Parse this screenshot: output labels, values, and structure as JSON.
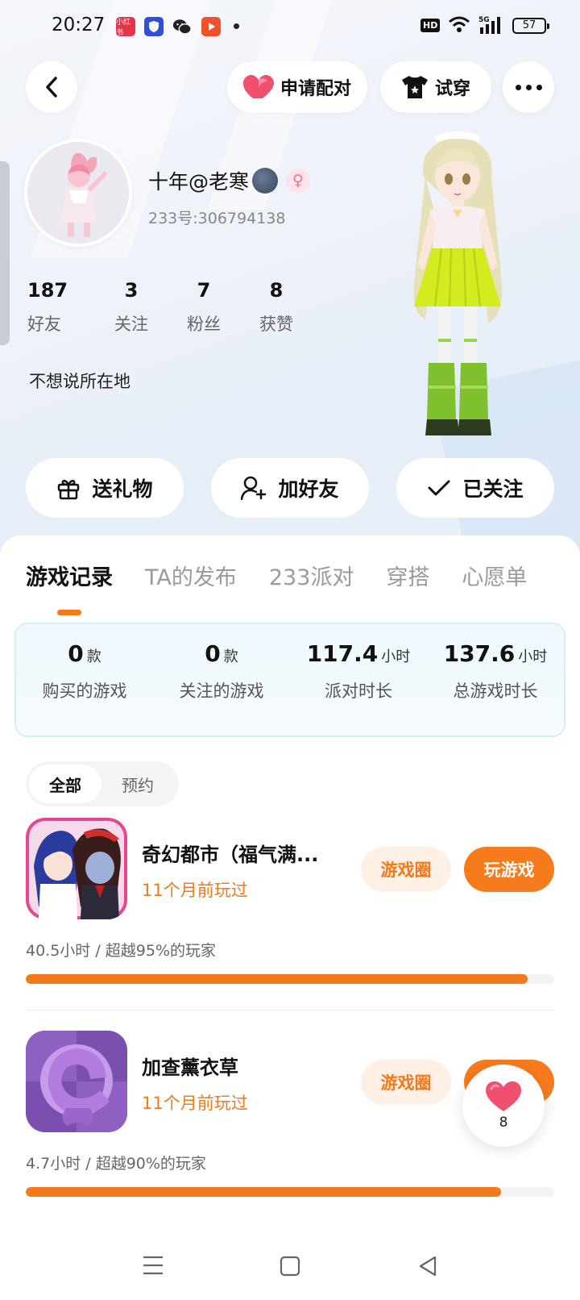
{
  "status_bar": {
    "time": "20:27",
    "battery": "57",
    "app_icons": [
      "xiaohongshu-app",
      "security-app",
      "wechat-app",
      "video-app"
    ]
  },
  "header": {
    "match_label": "申请配对",
    "try_on_label": "试穿"
  },
  "profile": {
    "nickname": "十年@老寒",
    "uid": "233号:306794138",
    "location": "不想说所在地",
    "stats": [
      {
        "value": "187",
        "label": "好友"
      },
      {
        "value": "3",
        "label": "关注"
      },
      {
        "value": "7",
        "label": "粉丝"
      },
      {
        "value": "8",
        "label": "获赞"
      }
    ]
  },
  "actions": {
    "gift": "送礼物",
    "add_friend": "加好友",
    "followed": "已关注"
  },
  "tabs": [
    "游戏记录",
    "TA的发布",
    "233派对",
    "穿搭",
    "心愿单"
  ],
  "summary": [
    {
      "value": "0",
      "unit": "款",
      "label": "购买的游戏"
    },
    {
      "value": "0",
      "unit": "款",
      "label": "关注的游戏"
    },
    {
      "value": "117.4",
      "unit": "小时",
      "label": "派对时长"
    },
    {
      "value": "137.6",
      "unit": "小时",
      "label": "总游戏时长"
    }
  ],
  "filter": {
    "all": "全部",
    "reserve": "预约"
  },
  "games": [
    {
      "name": "奇幻都市（福气满...",
      "last_played": "11个月前玩过",
      "circle": "游戏圈",
      "play": "玩游戏",
      "time_text": "40.5小时 / 超越95%的玩家",
      "progress": 0.95
    },
    {
      "name": "加查薰衣草",
      "last_played": "11个月前玩过",
      "circle": "游戏圈",
      "play": "玩游戏",
      "time_text": "4.7小时 / 超越90%的玩家",
      "progress": 0.9
    }
  ],
  "like": {
    "count": "8"
  },
  "colors": {
    "accent": "#f27a1a",
    "accent_light": "#fff0e6",
    "heart": "#f0506e"
  }
}
